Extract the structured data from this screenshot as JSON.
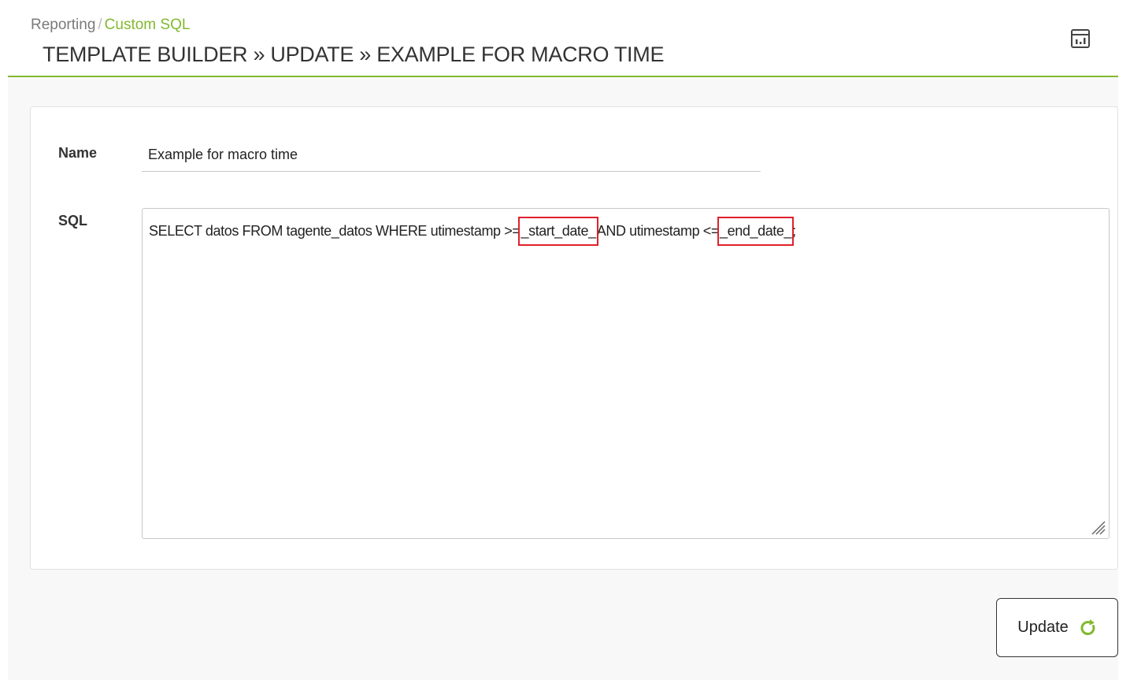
{
  "breadcrumb": {
    "parent": "Reporting",
    "separator": "/",
    "current": "Custom SQL"
  },
  "page_title": "TEMPLATE BUILDER » UPDATE » EXAMPLE FOR MACRO TIME",
  "header_icon": "report-view-icon",
  "form": {
    "name_label": "Name",
    "name_value": "Example for macro time",
    "sql_label": "SQL",
    "sql": {
      "part1": "SELECT datos FROM tagente_datos WHERE utimestamp >=",
      "macro_start": "_start_date_",
      "part2": "AND utimestamp <=",
      "macro_end": "_end_date_",
      "part3": ";"
    }
  },
  "update_button": {
    "label": "Update",
    "icon": "refresh-icon"
  },
  "colors": {
    "accent": "#82b92e",
    "highlight": "#e0202b"
  }
}
